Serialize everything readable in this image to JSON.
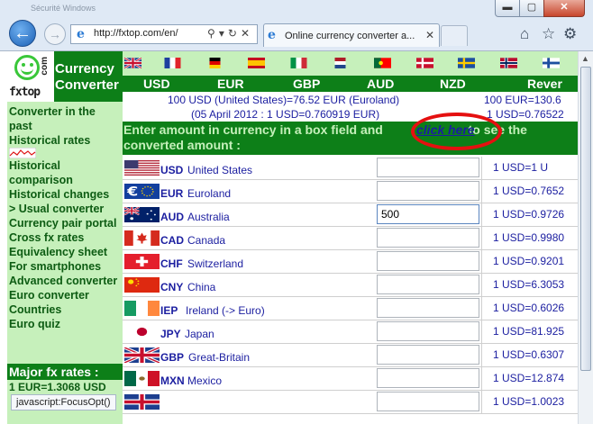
{
  "browser": {
    "title_hint": "Sécurité Windows",
    "url": "http://fxtop.com/en/",
    "tab_title": "Online currency converter a...",
    "window_controls": {
      "minimize": "▬",
      "maximize": "▢",
      "close": "✕"
    }
  },
  "site": {
    "logo_text": "fxtop",
    "logo_com": "com",
    "section_title_line1": "Currency",
    "section_title_line2": "Converter"
  },
  "sidebar": {
    "items": [
      "Converter in the past",
      "Historical rates",
      "Historical comparison",
      "Historical changes",
      "> Usual converter",
      "Currency pair portal",
      "Cross fx rates",
      "Equivalency sheet",
      "For smartphones",
      "Advanced converter",
      "Euro converter",
      "Countries",
      "Euro quiz"
    ],
    "major_title": "Major fx rates :",
    "major_rate": "1 EUR=1.3068 USD"
  },
  "header": {
    "currency_codes": [
      "USD",
      "EUR",
      "GBP",
      "AUD",
      "NZD",
      "Rever"
    ],
    "note_left_1": "100 USD (United States)=76.52 EUR (Euroland)",
    "note_left_2": "(05 April 2012 : 1 USD=0.760919 EUR)",
    "note_right_1": "100 EUR=130.6",
    "note_right_2": "1 USD=0.76522",
    "instruction_before": "Enter amount in currency in a box field and",
    "instruction_link": "click here",
    "instruction_after": "to see the",
    "instruction_line2": "converted amount :"
  },
  "currencies": [
    {
      "code": "USD",
      "name": "United States",
      "value": "",
      "rate": "1 USD=1 U"
    },
    {
      "code": "EUR",
      "name": "Euroland",
      "value": "",
      "rate": "1 USD=0.7652"
    },
    {
      "code": "AUD",
      "name": "Australia",
      "value": "500",
      "rate": "1 USD=0.9726"
    },
    {
      "code": "CAD",
      "name": "Canada",
      "value": "",
      "rate": "1 USD=0.9980"
    },
    {
      "code": "CHF",
      "name": "Switzerland",
      "value": "",
      "rate": "1 USD=0.9201"
    },
    {
      "code": "CNY",
      "name": "China",
      "value": "",
      "rate": "1 USD=6.3053"
    },
    {
      "code": "IEP",
      "name": "Ireland (-> Euro)",
      "value": "",
      "rate": "1 USD=0.6026"
    },
    {
      "code": "JPY",
      "name": "Japan",
      "value": "",
      "rate": "1 USD=81.925"
    },
    {
      "code": "GBP",
      "name": "Great-Britain",
      "value": "",
      "rate": "1 USD=0.6307"
    },
    {
      "code": "MXN",
      "name": "Mexico",
      "value": "",
      "rate": "1 USD=12.874"
    },
    {
      "code": "",
      "name": "",
      "value": "",
      "rate": "1 USD=1.0023"
    }
  ],
  "status": {
    "text": "javascript:FocusOpt()"
  },
  "colors": {
    "green_dark": "#0d7f18",
    "green_light": "#c6f0bb",
    "link_blue": "#1b1ea0",
    "oval_red": "#e51010"
  }
}
